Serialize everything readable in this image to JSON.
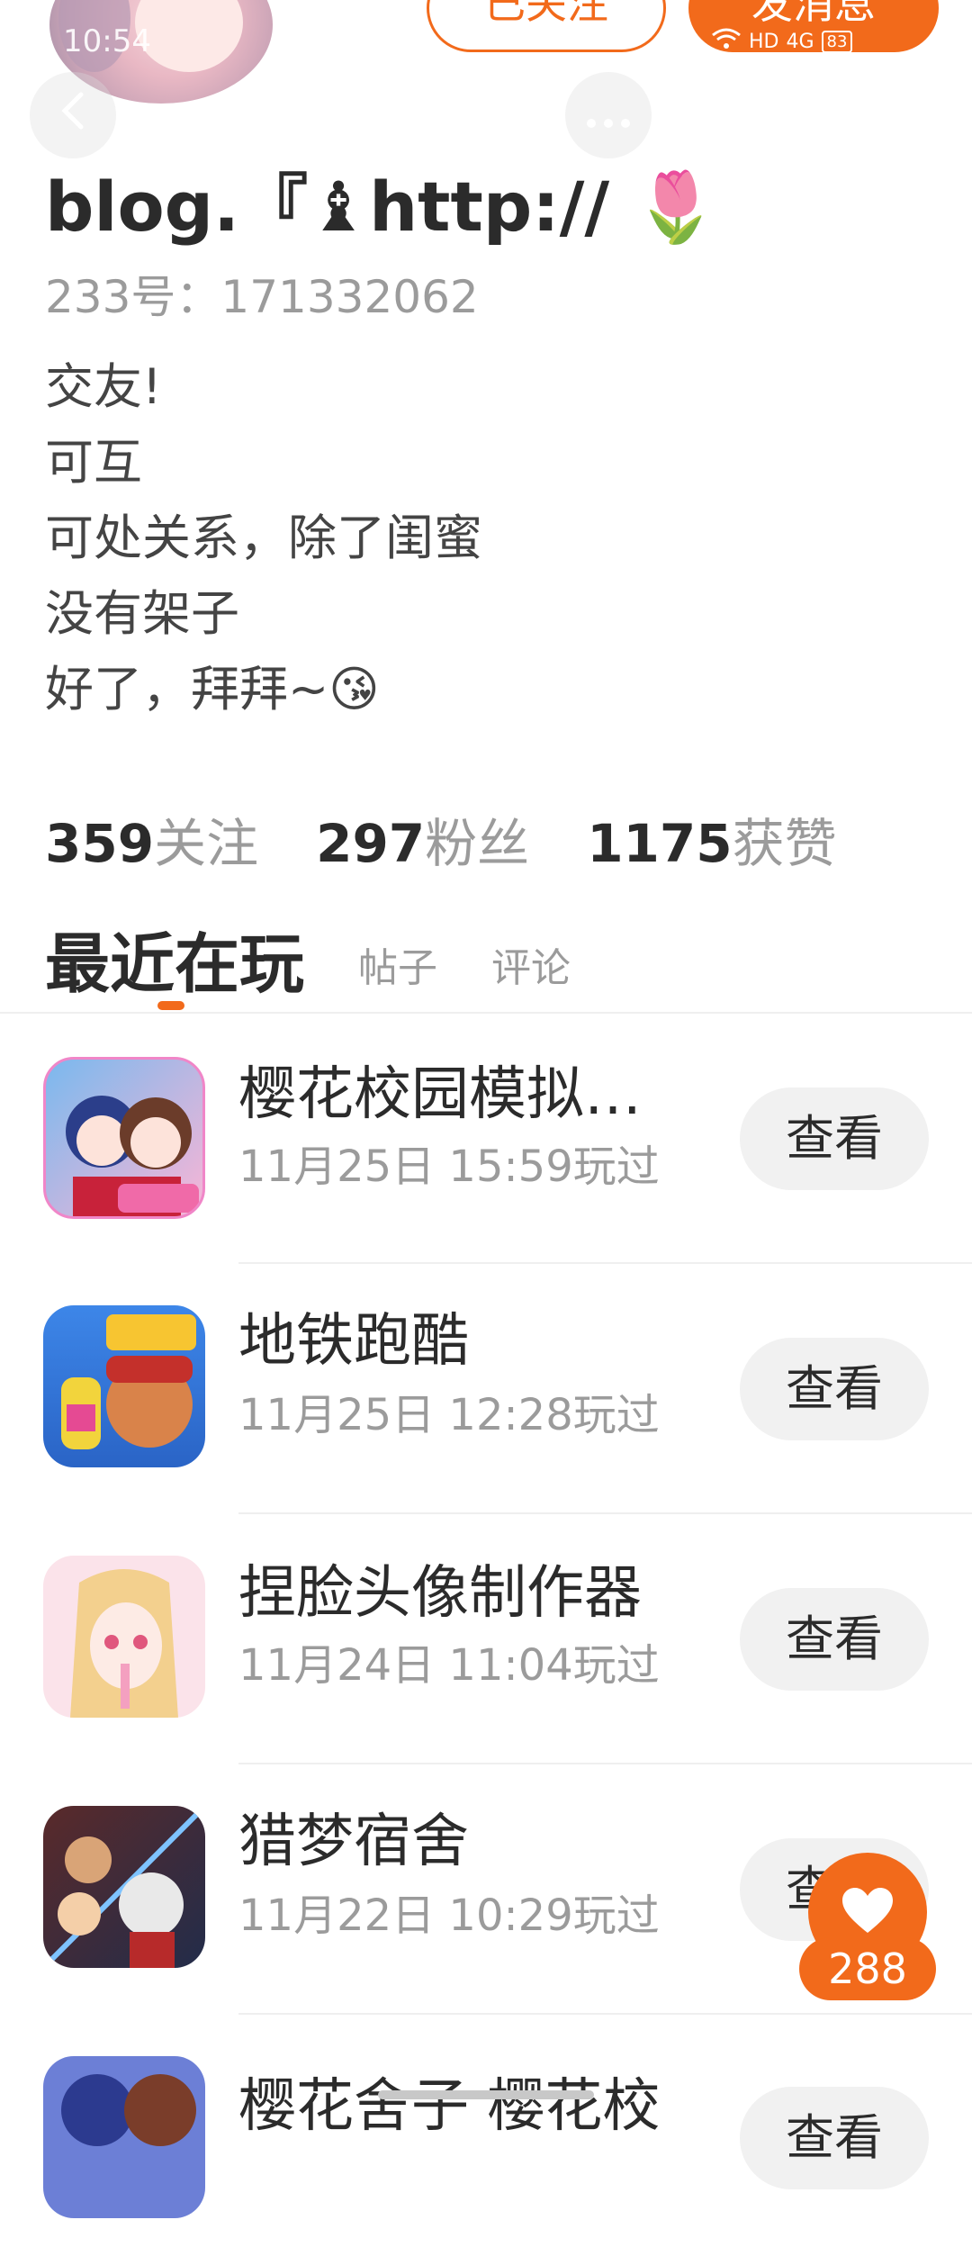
{
  "status_bar": {
    "time": "10:54",
    "net": "HD",
    "net2": "4G",
    "battery": "83"
  },
  "header": {
    "followed_label": "已关注",
    "message_label": "发消息"
  },
  "profile": {
    "nickname": "blog.『♝http:// 🌷",
    "uid": "233号：171332062",
    "bio": [
      "交友!",
      "可互",
      "可处关系，除了闺蜜",
      "没有架子",
      "好了，拜拜~😘"
    ]
  },
  "stats": [
    {
      "num": "359",
      "label": "关注"
    },
    {
      "num": "297",
      "label": "粉丝"
    },
    {
      "num": "1175",
      "label": "获赞"
    }
  ],
  "tabs": {
    "active": "最近在玩",
    "posts": "帖子",
    "comments": "评论"
  },
  "games": [
    {
      "name": "樱花校园模拟器...",
      "time": "11月25日 15:59玩过",
      "button": "查看"
    },
    {
      "name": "地铁跑酷",
      "time": "11月25日 12:28玩过",
      "button": "查看"
    },
    {
      "name": "捏脸头像制作器",
      "time": "11月24日 11:04玩过",
      "button": "查看"
    },
    {
      "name": "猎梦宿舍",
      "time": "11月22日 10:29玩过",
      "button": "查看"
    },
    {
      "name": "樱花舍子 樱花校",
      "time": "",
      "button": "查看"
    }
  ],
  "like": {
    "count": "288"
  },
  "icons": {
    "back": "back-arrow-icon",
    "more": "more-dots-icon",
    "like": "heart-icon"
  },
  "colors": {
    "accent": "#f26a1b",
    "muted": "#9b9b9b",
    "text": "#2b2b2b"
  }
}
